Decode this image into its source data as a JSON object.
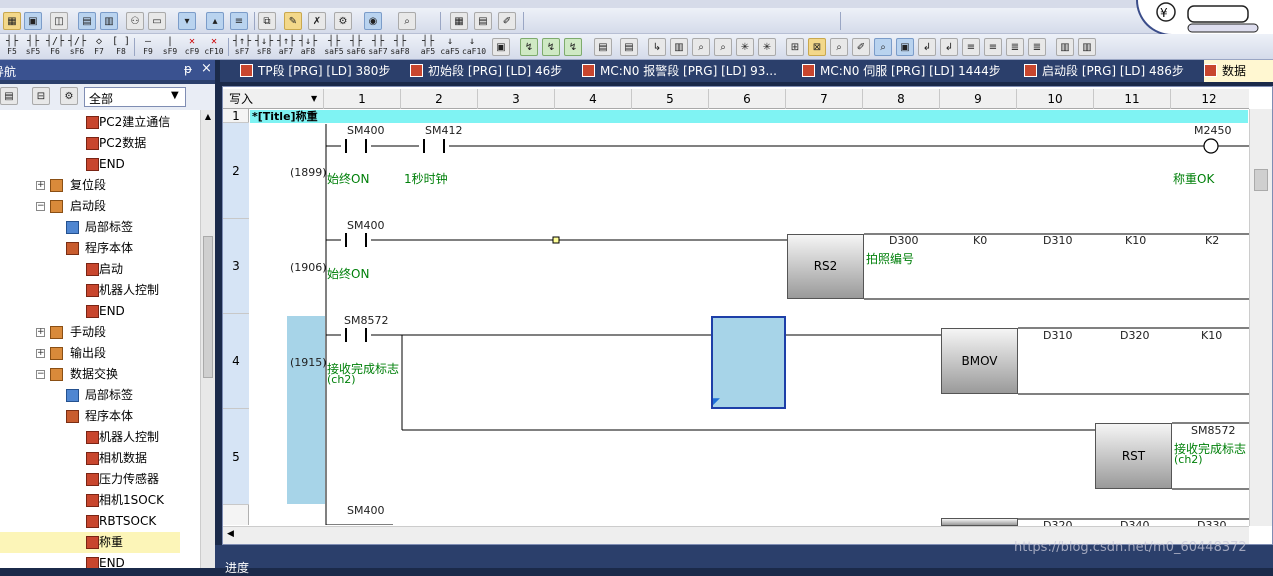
{
  "nav": {
    "title": "导航",
    "pin": "ᵽ",
    "close": "×",
    "filter": "全部"
  },
  "tree": [
    {
      "label": "PC2建立通信",
      "icon": "prog"
    },
    {
      "label": "PC2数据",
      "icon": "prog"
    },
    {
      "label": "END",
      "icon": "prog"
    },
    {
      "label": "复位段",
      "icon": "fold",
      "expander": "+"
    },
    {
      "label": "启动段",
      "icon": "fold",
      "expander": "−"
    },
    {
      "label": "局部标签",
      "icon": "lbl"
    },
    {
      "label": "程序本体",
      "icon": "body"
    },
    {
      "label": "启动",
      "icon": "prog"
    },
    {
      "label": "机器人控制",
      "icon": "prog"
    },
    {
      "label": "END",
      "icon": "prog"
    },
    {
      "label": "手动段",
      "icon": "fold",
      "expander": "+"
    },
    {
      "label": "输出段",
      "icon": "fold",
      "expander": "+"
    },
    {
      "label": "数据交换",
      "icon": "fold",
      "expander": "−"
    },
    {
      "label": "局部标签",
      "icon": "lbl"
    },
    {
      "label": "程序本体",
      "icon": "body"
    },
    {
      "label": "机器人控制",
      "icon": "prog"
    },
    {
      "label": "相机数据",
      "icon": "prog"
    },
    {
      "label": "压力传感器",
      "icon": "prog"
    },
    {
      "label": "相机1SOCK",
      "icon": "prog"
    },
    {
      "label": "RBTSOCK",
      "icon": "prog"
    },
    {
      "label": "称重",
      "icon": "prog",
      "selected": true
    },
    {
      "label": "END",
      "icon": "prog"
    }
  ],
  "tabs": [
    {
      "label": "TP段 [PRG] [LD] 380步"
    },
    {
      "label": "初始段 [PRG] [LD] 46步"
    },
    {
      "label": "MC:N0 报警段 [PRG] [LD] 93..."
    },
    {
      "label": "MC:N0 伺服 [PRG] [LD] 1444步"
    },
    {
      "label": "启动段 [PRG] [LD] 486步"
    },
    {
      "label": "数据",
      "active": true
    }
  ],
  "fkeys": [
    "F5",
    "sF5",
    "F6",
    "sF6",
    "F7",
    "F8",
    "F9",
    "sF9",
    "cF9",
    "cF10",
    "sF7",
    "sF8",
    "aF7",
    "aF8",
    "saF5",
    "saF6",
    "saF7",
    "saF8",
    "aF5",
    "caF5",
    "caF10"
  ],
  "editor": {
    "mode": "写入",
    "columns": [
      "1",
      "2",
      "3",
      "4",
      "5",
      "6",
      "7",
      "8",
      "9",
      "10",
      "11",
      "12"
    ],
    "rows": [
      "1",
      "2",
      "3",
      "4",
      "5"
    ],
    "title": "*[Title]称重"
  },
  "ladder": {
    "r2": {
      "step": "(1899)",
      "c1": "SM400",
      "c1cmt": "始终ON",
      "c2": "SM412",
      "c2cmt": "1秒时钟",
      "coil": "M2450",
      "coilcmt": "称重OK"
    },
    "r3": {
      "step": "(1906)",
      "c1": "SM400",
      "c1cmt": "始终ON",
      "fb": "RS2",
      "a1": "D300",
      "a1cmt": "拍照编号",
      "a2": "K0",
      "a3": "D310",
      "a4": "K10",
      "a5": "K2"
    },
    "r4": {
      "step": "(1915)",
      "c1": "SM8572",
      "c1cmt": "接收完成标志",
      "c1cmt2": "(ch2)",
      "fb": "BMOV",
      "a1": "D310",
      "a2": "D320",
      "a3": "K10"
    },
    "r5": {
      "fb": "RST",
      "a1": "SM8572",
      "a1cmt": "接收完成标志",
      "a1cmt2": "(ch2)"
    },
    "r6": {
      "c1": "SM400",
      "a1": "D320",
      "a2": "D340",
      "a3": "D330"
    }
  },
  "status": {
    "progress": "进度"
  },
  "watermark": "https://blog.csdn.net/m0_60448372"
}
